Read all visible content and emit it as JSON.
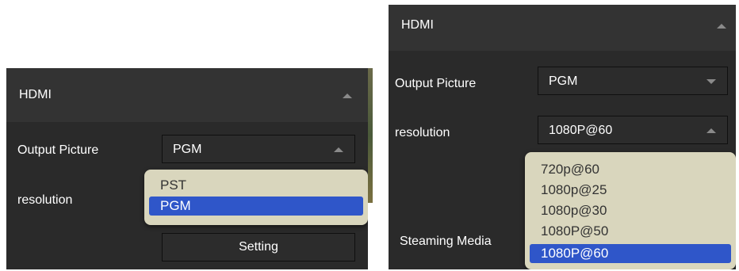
{
  "left_panel": {
    "header": {
      "title": "HDMI"
    },
    "output_picture": {
      "label": "Output Picture",
      "value": "PGM"
    },
    "resolution": {
      "label": "resolution"
    },
    "dropdown": {
      "options": [
        {
          "label": "PST",
          "selected": false
        },
        {
          "label": "PGM",
          "selected": true
        }
      ]
    },
    "setting_button": {
      "label": "Setting"
    }
  },
  "right_panel": {
    "header": {
      "title": "HDMI"
    },
    "output_picture": {
      "label": "Output Picture",
      "value": "PGM"
    },
    "resolution": {
      "label": "resolution",
      "value": "1080P@60"
    },
    "dropdown": {
      "options": [
        {
          "label": "720p@60",
          "selected": false
        },
        {
          "label": "1080p@25",
          "selected": false
        },
        {
          "label": "1080p@30",
          "selected": false
        },
        {
          "label": "1080P@50",
          "selected": false
        },
        {
          "label": "1080P@60",
          "selected": true
        }
      ]
    },
    "streaming_media": {
      "label": "Steaming Media"
    }
  },
  "colors": {
    "panel_bg": "#2a2a2a",
    "header_bg": "#333333",
    "dropdown_bg": "#d9d6bd",
    "selection": "#2f56c9"
  }
}
